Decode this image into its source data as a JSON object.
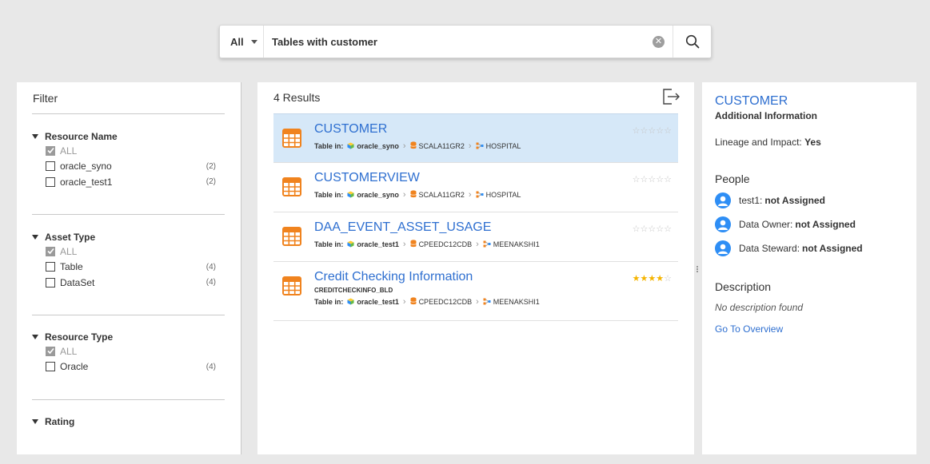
{
  "search": {
    "scope": "All",
    "query": "Tables with customer"
  },
  "filter": {
    "title": "Filter",
    "groups": [
      {
        "name": "Resource Name",
        "items": [
          {
            "label": "ALL",
            "checked": true,
            "count": ""
          },
          {
            "label": "oracle_syno",
            "checked": false,
            "count": "(2)"
          },
          {
            "label": "oracle_test1",
            "checked": false,
            "count": "(2)"
          }
        ]
      },
      {
        "name": "Asset Type",
        "items": [
          {
            "label": "ALL",
            "checked": true,
            "count": ""
          },
          {
            "label": "Table",
            "checked": false,
            "count": "(4)"
          },
          {
            "label": "DataSet",
            "checked": false,
            "count": "(4)"
          }
        ]
      },
      {
        "name": "Resource Type",
        "items": [
          {
            "label": "ALL",
            "checked": true,
            "count": ""
          },
          {
            "label": "Oracle",
            "checked": false,
            "count": "(4)"
          }
        ]
      },
      {
        "name": "Rating",
        "items": []
      }
    ]
  },
  "results": {
    "count_label": "4 Results",
    "path_label": "Table in:",
    "items": [
      {
        "title": "CUSTOMER",
        "subtitle": "",
        "resource": "oracle_syno",
        "schema": "SCALA11GR2",
        "owner": "HOSPITAL",
        "rating": 0,
        "selected": true
      },
      {
        "title": "CUSTOMERVIEW",
        "subtitle": "",
        "resource": "oracle_syno",
        "schema": "SCALA11GR2",
        "owner": "HOSPITAL",
        "rating": 0,
        "selected": false
      },
      {
        "title": "DAA_EVENT_ASSET_USAGE",
        "subtitle": "",
        "resource": "oracle_test1",
        "schema": "CPEEDC12CDB",
        "owner": "MEENAKSHI1",
        "rating": 0,
        "selected": false
      },
      {
        "title": "Credit Checking Information",
        "subtitle": "CREDITCHECKINFO_BLD",
        "resource": "oracle_test1",
        "schema": "CPEEDC12CDB",
        "owner": "MEENAKSHI1",
        "rating": 4,
        "selected": false
      }
    ]
  },
  "detail": {
    "title": "CUSTOMER",
    "subtitle": "Additional Information",
    "lineage_label": "Lineage and Impact:",
    "lineage_value": "Yes",
    "people_heading": "People",
    "people": [
      {
        "role": "test1:",
        "value": "not Assigned"
      },
      {
        "role": "Data Owner:",
        "value": "not Assigned"
      },
      {
        "role": "Data Steward:",
        "value": "not Assigned"
      }
    ],
    "description_heading": "Description",
    "description": "No description found",
    "overview_link": "Go To Overview"
  },
  "colors": {
    "accent": "#2e6fd0",
    "selected_row": "#d6e8f8",
    "table_icon": "#f0831e",
    "star": "#f5b400",
    "avatar": "#2e8ef5"
  }
}
